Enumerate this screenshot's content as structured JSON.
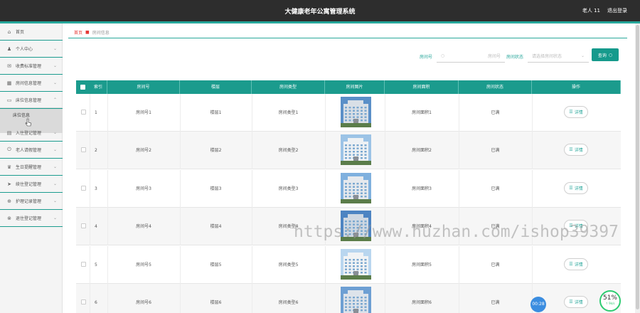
{
  "header": {
    "title": "大健康老年公寓管理系统",
    "user": "老人 11",
    "logout": "退出登录"
  },
  "sidebar": {
    "items": [
      {
        "label": "首页",
        "icon": "home-icon",
        "glyph": "⌂",
        "chev": ""
      },
      {
        "label": "个人中心",
        "icon": "user-icon",
        "glyph": "♟",
        "chev": "⌄"
      },
      {
        "label": "收费标准管理",
        "icon": "tag-icon",
        "glyph": "✉",
        "chev": "⌄"
      },
      {
        "label": "房间信息管理",
        "icon": "building-icon",
        "glyph": "▦",
        "chev": "⌄"
      },
      {
        "label": "床位信息管理",
        "icon": "bed-icon",
        "glyph": "▭",
        "chev": "⌃"
      },
      {
        "label": "入住登记管理",
        "icon": "register-icon",
        "glyph": "▤",
        "chev": "⌄"
      },
      {
        "label": "老人请假管理",
        "icon": "leave-icon",
        "glyph": "⏻",
        "chev": "⌄"
      },
      {
        "label": "生日提醒管理",
        "icon": "gift-icon",
        "glyph": "♛",
        "chev": "⌄"
      },
      {
        "label": "续住登记管理",
        "icon": "send-icon",
        "glyph": "➤",
        "chev": "⌄"
      },
      {
        "label": "护理记录管理",
        "icon": "nurse-icon",
        "glyph": "⊕",
        "chev": "⌄"
      },
      {
        "label": "退住登记管理",
        "icon": "checkout-icon",
        "glyph": "⊗",
        "chev": "⌄"
      }
    ],
    "submenu_label": "床位信息"
  },
  "breadcrumb": {
    "home": "首页",
    "current": "房间信息"
  },
  "search": {
    "room_label": "房间号",
    "room_placeholder": "房间号",
    "status_label": "房间状态",
    "status_placeholder": "请选择房间状态",
    "button": "查询"
  },
  "table": {
    "headers": [
      "索引",
      "房间号",
      "楼层",
      "房间类型",
      "房间图片",
      "房间面积",
      "房间状态",
      "操作"
    ],
    "detail_label": "详情",
    "rows": [
      {
        "index": "1",
        "room": "房间号1",
        "floor": "楼层1",
        "type": "房间类型1",
        "area": "房间面积1",
        "status": "已满"
      },
      {
        "index": "2",
        "room": "房间号2",
        "floor": "楼层2",
        "type": "房间类型2",
        "area": "房间面积2",
        "status": "已满"
      },
      {
        "index": "3",
        "room": "房间号3",
        "floor": "楼层3",
        "type": "房间类型3",
        "area": "房间面积3",
        "status": "已满"
      },
      {
        "index": "4",
        "room": "房间号4",
        "floor": "楼层4",
        "type": "房间类型4",
        "area": "房间面积4",
        "status": "已满"
      },
      {
        "index": "5",
        "room": "房间号5",
        "floor": "楼层5",
        "type": "房间类型5",
        "area": "房间面积5",
        "status": "已满"
      },
      {
        "index": "6",
        "room": "房间号6",
        "floor": "楼层6",
        "type": "房间类型6",
        "area": "房间面积6",
        "status": "已满"
      }
    ]
  },
  "watermark": "https://www.huzhan.com/ishop39397",
  "overlay": {
    "timer": "00:28",
    "gauge_percent": "51%",
    "gauge_speed": "↑ 9k/s"
  },
  "colors": {
    "accent": "#26a69a",
    "header_bg": "#2d2d2d",
    "table_header": "#1b9b8d"
  }
}
